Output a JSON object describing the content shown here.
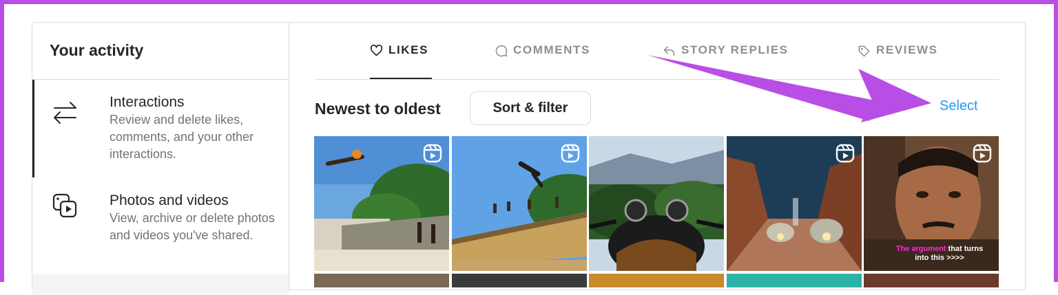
{
  "sidebar": {
    "title": "Your activity",
    "items": [
      {
        "label": "Interactions",
        "description": "Review and delete likes, comments, and your other interactions.",
        "icon": "swap-arrows-icon"
      },
      {
        "label": "Photos and videos",
        "description": "View, archive or delete photos and videos you've shared.",
        "icon": "photos-icon"
      }
    ]
  },
  "tabs": [
    {
      "label": "LIKES",
      "icon": "heart-icon",
      "active": true
    },
    {
      "label": "COMMENTS",
      "icon": "comment-icon",
      "active": false
    },
    {
      "label": "STORY REPLIES",
      "icon": "reply-icon",
      "active": false
    },
    {
      "label": "REVIEWS",
      "icon": "tag-icon",
      "active": false
    }
  ],
  "toolbar": {
    "sort_label": "Newest to oldest",
    "sort_filter_button": "Sort & filter",
    "select_link": "Select"
  },
  "grid": {
    "items": [
      {
        "type": "reel",
        "icon": "reels-icon"
      },
      {
        "type": "reel",
        "icon": "reels-icon"
      },
      {
        "type": "photo"
      },
      {
        "type": "reel",
        "icon": "reels-icon"
      },
      {
        "type": "reel",
        "icon": "reels-icon",
        "caption_highlight": "The argument",
        "caption_rest": " that turns into this >>>>"
      }
    ]
  },
  "colors": {
    "accent_link": "#1f9bf0",
    "annotation_arrow": "#b94ee6",
    "frame_border": "#b94ee6"
  }
}
